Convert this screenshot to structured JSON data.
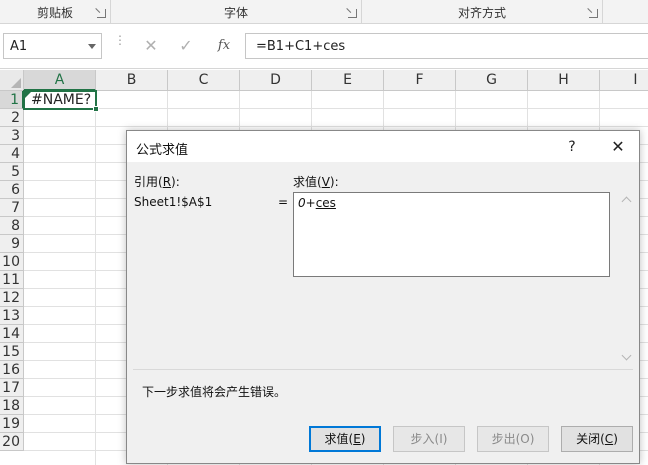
{
  "ribbon": {
    "groups": [
      {
        "label": "剪贴板"
      },
      {
        "label": "字体"
      },
      {
        "label": "对齐方式"
      }
    ]
  },
  "formula_bar": {
    "name_box": "A1",
    "formula": "=B1+C1+ces",
    "cancel_glyph": "✕",
    "enter_glyph": "✓",
    "fx_glyph": "fx"
  },
  "sheet": {
    "columns": [
      "A",
      "B",
      "C",
      "D",
      "E",
      "F",
      "G",
      "H",
      "I"
    ],
    "rows": [
      "1",
      "2",
      "3",
      "4",
      "5",
      "6",
      "7",
      "8",
      "9",
      "10",
      "11",
      "12",
      "13",
      "14",
      "15",
      "16",
      "17",
      "18",
      "19",
      "20"
    ],
    "active_cell_value": "#NAME?"
  },
  "dialog": {
    "title": "公式求值",
    "help_glyph": "?",
    "close_glyph": "✕",
    "reference_label": "引用(",
    "reference_key": "R",
    "reference_label_end": "):",
    "evaluation_label": "求值(",
    "evaluation_key": "V",
    "evaluation_label_end": "):",
    "reference_value": "Sheet1!$A$1",
    "equals": "=",
    "evaluation_zero": "0",
    "evaluation_plus": "+",
    "evaluation_ces": "ces",
    "message": "下一步求值将会产生错误。",
    "buttons": {
      "evaluate": {
        "label": "求值(",
        "key": "E",
        "end": ")"
      },
      "step_in": "步入(I)",
      "step_out": "步出(O)",
      "close": {
        "label": "关闭(",
        "key": "C",
        "end": ")"
      }
    }
  },
  "colors": {
    "accent_green": "#217346",
    "default_button_border": "#0078d7"
  }
}
